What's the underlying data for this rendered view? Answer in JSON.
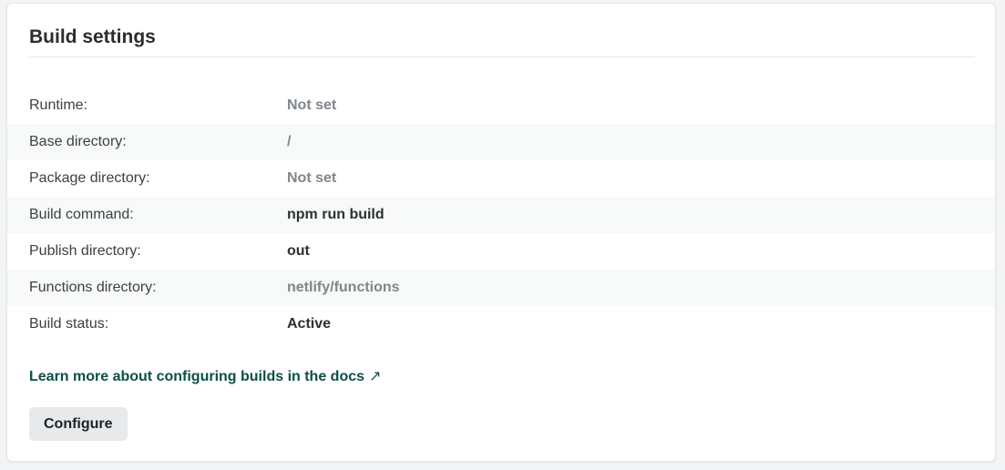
{
  "card": {
    "title": "Build settings"
  },
  "settings": [
    {
      "label": "Runtime:",
      "value": "Not set",
      "muted": true
    },
    {
      "label": "Base directory:",
      "value": "/",
      "muted": true
    },
    {
      "label": "Package directory:",
      "value": "Not set",
      "muted": true
    },
    {
      "label": "Build command:",
      "value": "npm run build",
      "muted": false
    },
    {
      "label": "Publish directory:",
      "value": "out",
      "muted": false
    },
    {
      "label": "Functions directory:",
      "value": "netlify/functions",
      "muted": true
    },
    {
      "label": "Build status:",
      "value": "Active",
      "muted": false
    }
  ],
  "docs_link": {
    "label": "Learn more about configuring builds in the docs",
    "icon": "external-arrow-icon",
    "glyph": "↗"
  },
  "configure_button": {
    "label": "Configure"
  },
  "colors": {
    "link": "#0b4f47",
    "muted_value": "#80868c",
    "strong_value": "#2d3034"
  }
}
